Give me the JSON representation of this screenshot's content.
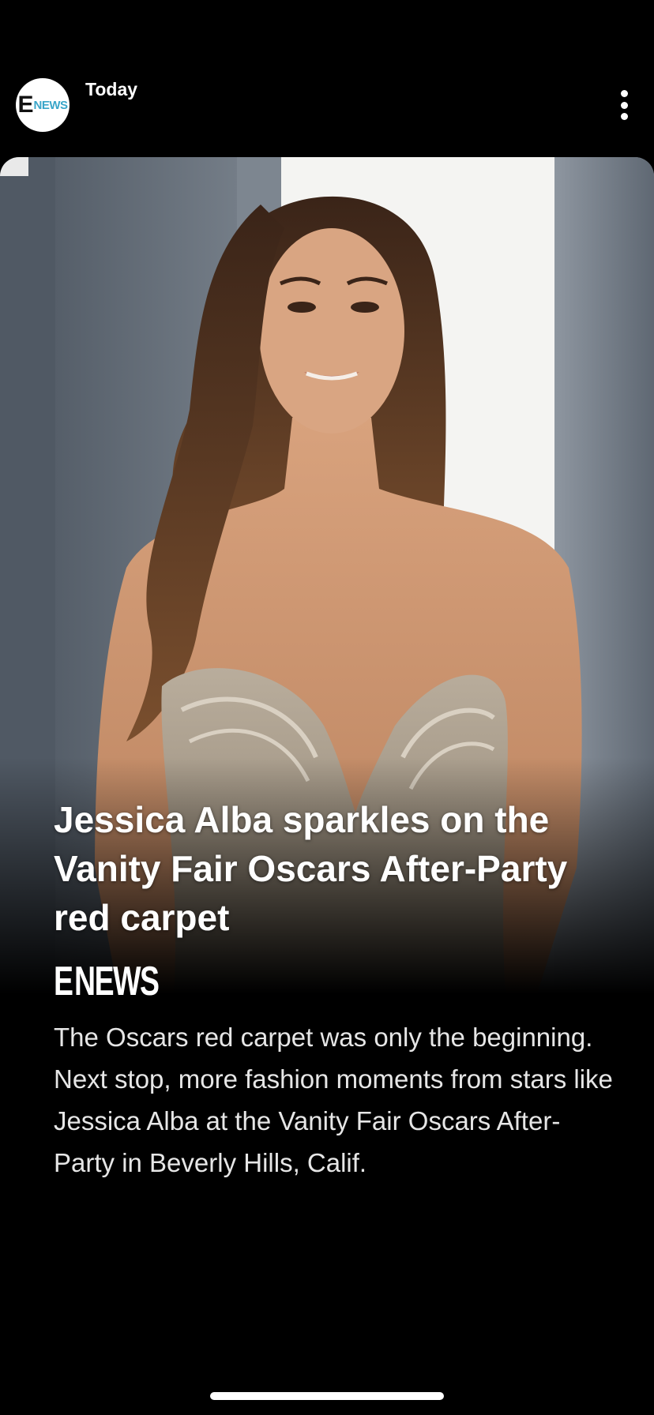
{
  "header": {
    "avatar_logo_e": "E",
    "avatar_logo_news": "NEWS",
    "time_label": "Today",
    "more_icon": "more-vertical-icon"
  },
  "story": {
    "title": "Jessica Alba sparkles on the Vanity Fair Oscars After-Party red carpet",
    "source_logo_e": "E",
    "source_logo_news": "NEWS",
    "description": "The Oscars red carpet was only the beginning. Next stop, more fashion moments from stars like Jessica Alba at the Vanity Fair Oscars After-Party in Beverly Hills, Calif."
  },
  "colors": {
    "background": "#000000",
    "text": "#ffffff",
    "news_accent": "#3aa6c9"
  }
}
